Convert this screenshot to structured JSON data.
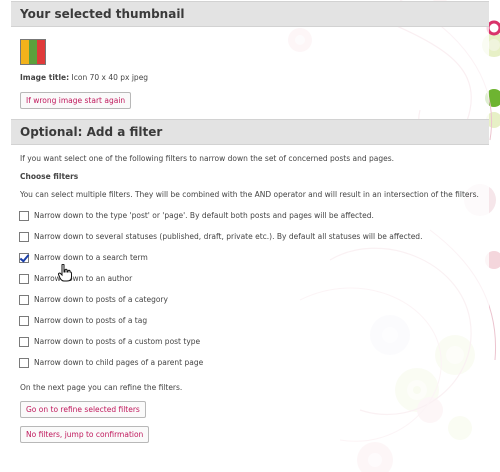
{
  "thumbnail": {
    "section_title": "Your selected thumbnail",
    "colors": [
      "#f2b21b",
      "#5ca03c",
      "#e03a3a"
    ],
    "image_title_label": "Image title:",
    "image_title_value": "Icon 70 x 40 px jpeg",
    "wrong_image_button": "If wrong image start again"
  },
  "filter": {
    "section_title": "Optional: Add a filter",
    "intro": "If you want select one of the following filters to narrow down the set of concerned posts and pages.",
    "choose_label": "Choose filters",
    "multi_note": "You can select multiple filters. They will be combined with the AND operator and will result in an intersection of the filters.",
    "options": [
      {
        "label": "Narrow down to the type 'post' or 'page'. By default both posts and pages will be affected.",
        "checked": false
      },
      {
        "label": "Narrow down to several statuses (published, draft, private etc.). By default all statuses will be affected.",
        "checked": false
      },
      {
        "label": "Narrow down to a search term",
        "checked": true
      },
      {
        "label": "Narrow down to an author",
        "checked": false
      },
      {
        "label": "Narrow down to posts of a category",
        "checked": false
      },
      {
        "label": "Narrow down to posts of a tag",
        "checked": false
      },
      {
        "label": "Narrow down to posts of a custom post type",
        "checked": false
      },
      {
        "label": "Narrow down to child pages of a parent page",
        "checked": false
      }
    ],
    "next_note": "On the next page you can refine the filters.",
    "refine_button": "Go on to refine selected filters",
    "skip_button": "No filters, jump to confirmation"
  },
  "colors": {
    "accent": "#c0185c",
    "header_bg": "#e3e3e3"
  },
  "icons": {
    "cursor": "hand-pointer-icon"
  }
}
